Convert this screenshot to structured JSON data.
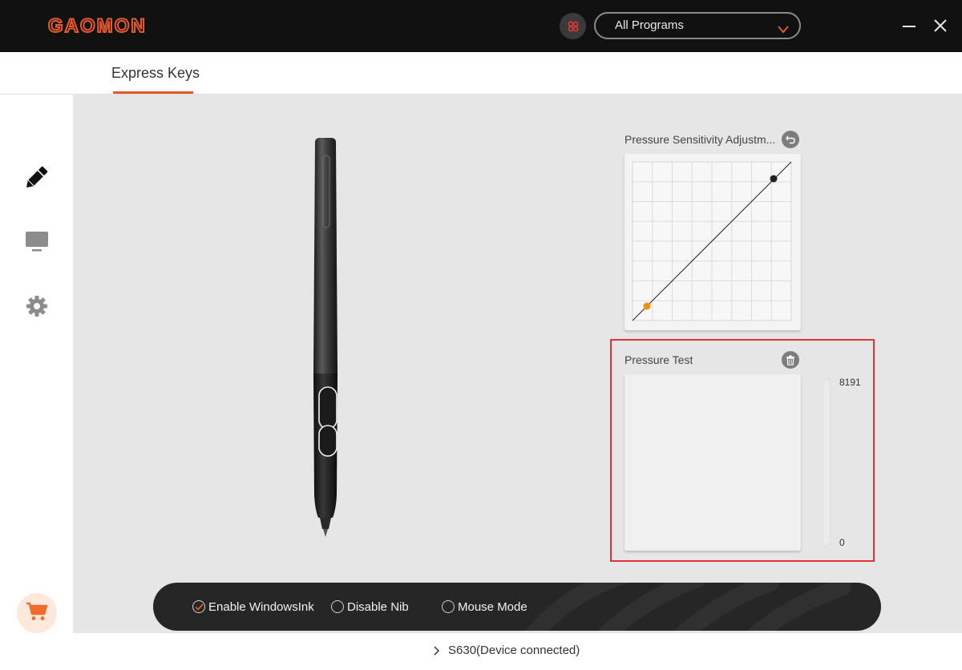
{
  "header": {
    "logo_text": "GAOMON",
    "program_select_value": "All Programs",
    "app_icon": "app-grid-icon",
    "minimize_icon": "minimize-icon",
    "close_icon": "close-icon"
  },
  "tabs": [
    {
      "label": "Express Keys",
      "active": true
    }
  ],
  "sidebar": {
    "items": [
      {
        "name": "pen",
        "icon": "pen-icon",
        "active": true
      },
      {
        "name": "display",
        "icon": "monitor-icon",
        "active": false
      },
      {
        "name": "settings",
        "icon": "gear-icon",
        "active": false
      }
    ],
    "cart_icon": "cart-icon"
  },
  "pressure_sensitivity": {
    "title": "Pressure Sensitivity Adjustm...",
    "reset_icon": "undo-icon"
  },
  "pressure_test": {
    "title": "Pressure Test",
    "clear_icon": "trash-icon",
    "max_label": "8191",
    "min_label": "0",
    "level": 0
  },
  "options": {
    "windows_ink": {
      "label": "Enable WindowsInk",
      "checked": true
    },
    "disable_nib": {
      "label": "Disable Nib",
      "checked": false
    },
    "mouse_mode": {
      "label": "Mouse Mode",
      "checked": false
    }
  },
  "status": {
    "device_text": "S630(Device connected)"
  },
  "colors": {
    "accent": "#e8582a",
    "titlebar": "#111111",
    "highlight": "#e0333a"
  }
}
